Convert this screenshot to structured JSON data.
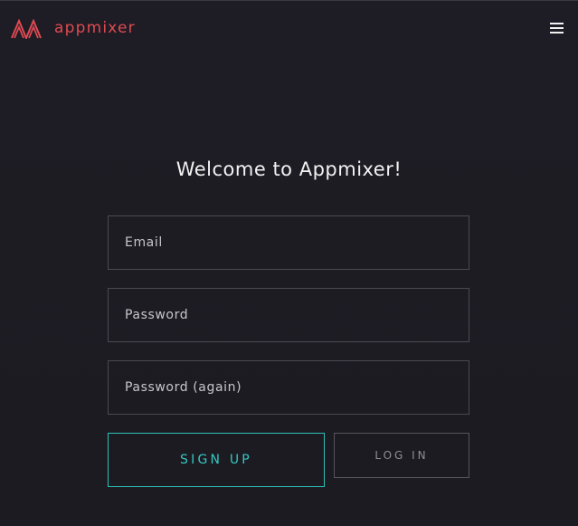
{
  "header": {
    "logo_text": "appmixer",
    "logo_icon": "appmixer-logo-icon",
    "menu_icon": "hamburger-menu-icon"
  },
  "main": {
    "title": "Welcome to Appmixer!",
    "fields": {
      "email_placeholder": "Email",
      "password_placeholder": "Password",
      "password_again_placeholder": "Password (again)"
    },
    "buttons": {
      "signup_label": "SIGN UP",
      "login_label": "LOG IN"
    }
  },
  "colors": {
    "background": "#1d1b23",
    "brand": "#e04a53",
    "accent": "#35c8c2",
    "text": "#f2f2f2",
    "border": "#4b4951"
  }
}
